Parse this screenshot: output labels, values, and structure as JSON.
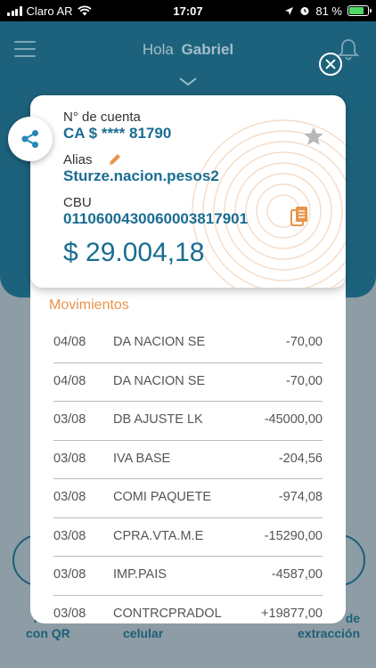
{
  "status_bar": {
    "carrier": "Claro AR",
    "time": "17:07",
    "battery": "81 %",
    "battery_level": 0.81
  },
  "header": {
    "greeting": "Hola",
    "user_name": "Gabriel"
  },
  "account": {
    "number_label": "N° de cuenta",
    "number_value": "CA $ **** 81790",
    "alias_label": "Alias",
    "alias_value": "Sturze.nacion.pesos2",
    "cbu_label": "CBU",
    "cbu_value": "0110600430060003817901",
    "balance": "$ 29.004,18"
  },
  "movements": {
    "title": "Movimientos",
    "rows": [
      {
        "date": "04/08",
        "description": "DA NACION SE",
        "amount": "-70,00"
      },
      {
        "date": "04/08",
        "description": "DA NACION SE",
        "amount": "-70,00"
      },
      {
        "date": "03/08",
        "description": "DB AJUSTE LK",
        "amount": "-45000,00"
      },
      {
        "date": "03/08",
        "description": "IVA BASE",
        "amount": "-204,56"
      },
      {
        "date": "03/08",
        "description": "COMI PAQUETE",
        "amount": "-974,08"
      },
      {
        "date": "03/08",
        "description": "CPRA.VTA.M.E",
        "amount": "-15290,00"
      },
      {
        "date": "03/08",
        "description": "IMP.PAIS",
        "amount": "-4587,00"
      },
      {
        "date": "03/08",
        "description": "CONTRCPRADOL",
        "amount": "+19877,00"
      }
    ]
  },
  "background_labels": {
    "left_line1": "P",
    "left_line2": "con QR",
    "center_line1": "celular",
    "right_line1": "de",
    "right_line2": "extracción"
  },
  "icons": {
    "share": "share-icon",
    "close": "close-icon",
    "star": "star-icon",
    "edit": "pencil-icon",
    "copy": "copy-icon",
    "menu": "hamburger-icon",
    "notifications": "bell-icon"
  },
  "colors": {
    "header_bg": "#1d627c",
    "accent_blue": "#1a6c92",
    "accent_orange": "#e8944a",
    "overlay_bg": "#8d9ca5"
  }
}
